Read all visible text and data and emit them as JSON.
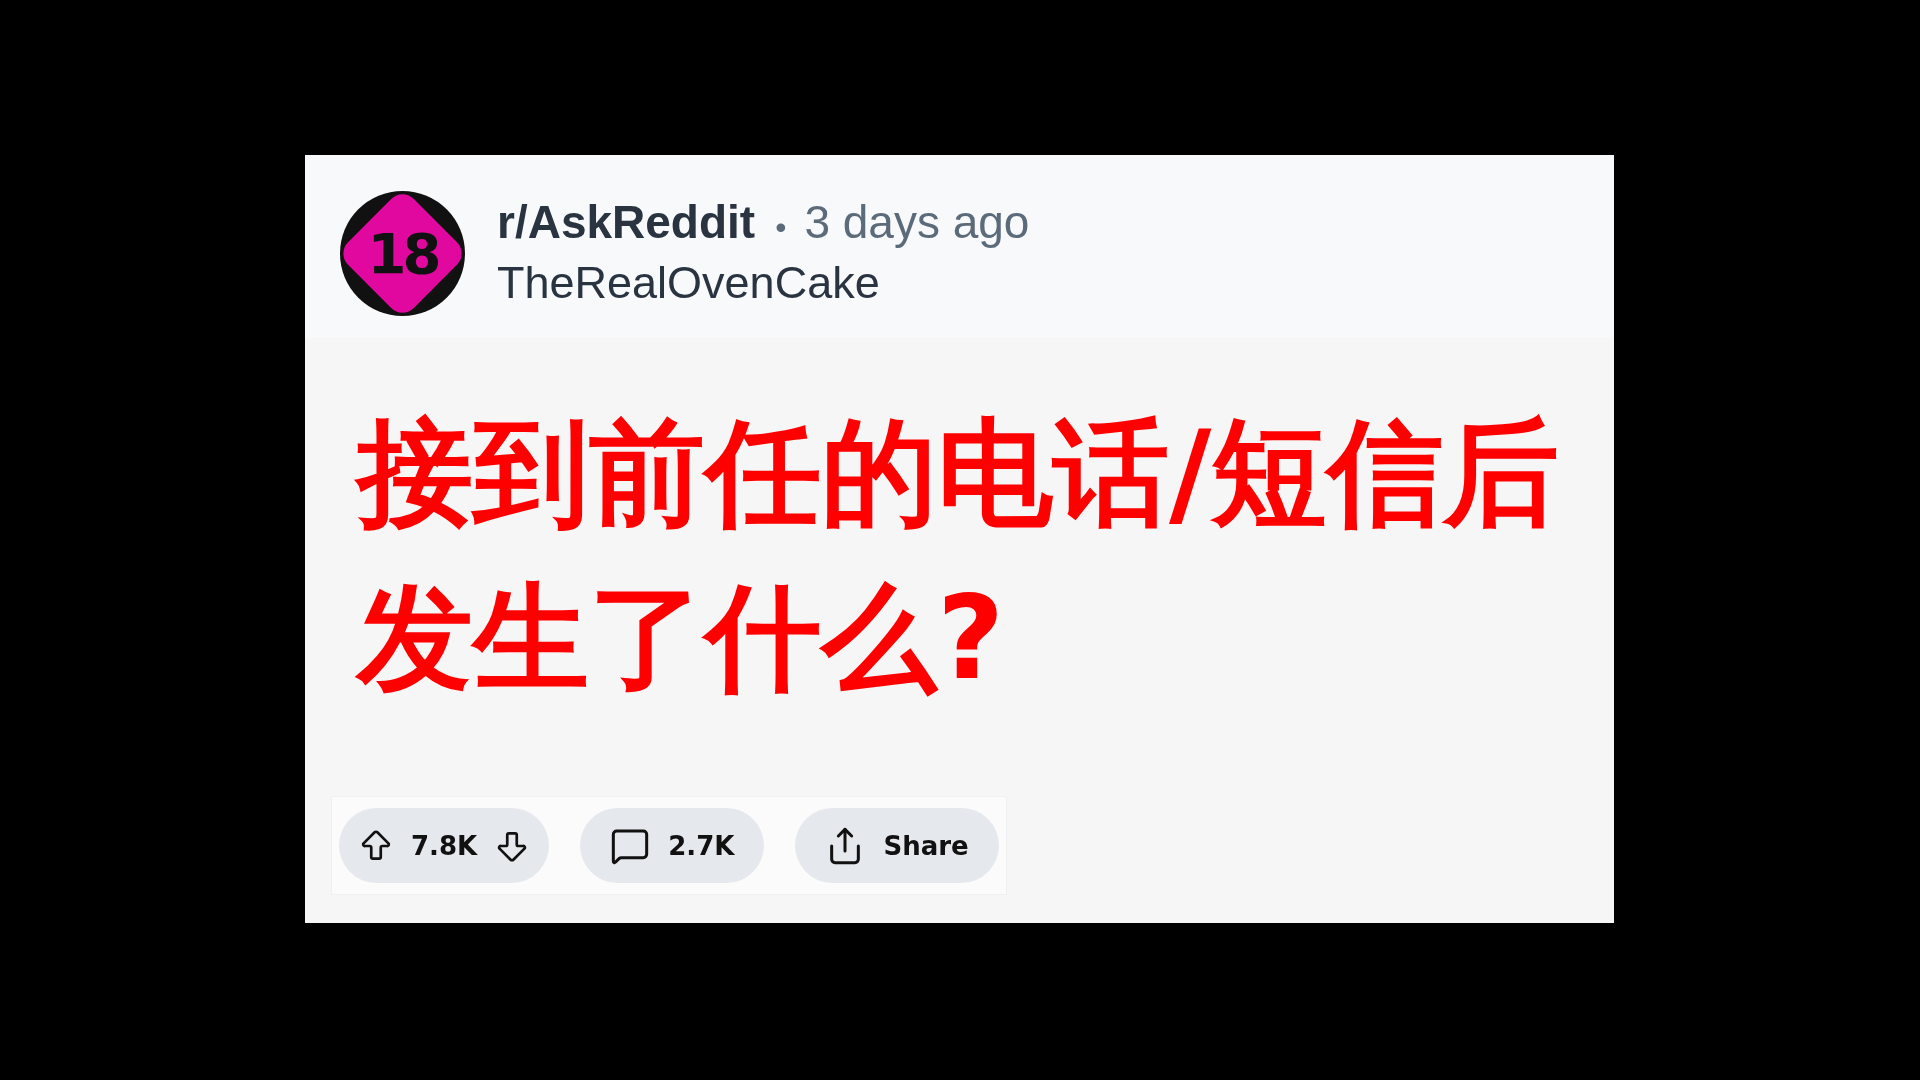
{
  "post": {
    "avatar_label": "18",
    "subreddit": "r/AskReddit",
    "separator": "•",
    "time": "3 days ago",
    "author": "TheRealOvenCake",
    "title": "接到前任的电话/短信后发生了什么?"
  },
  "actions": [
    {
      "kind": "vote",
      "count": "7.8K"
    },
    {
      "kind": "comments",
      "count": "2.7K"
    },
    {
      "kind": "share",
      "label": "Share"
    }
  ]
}
